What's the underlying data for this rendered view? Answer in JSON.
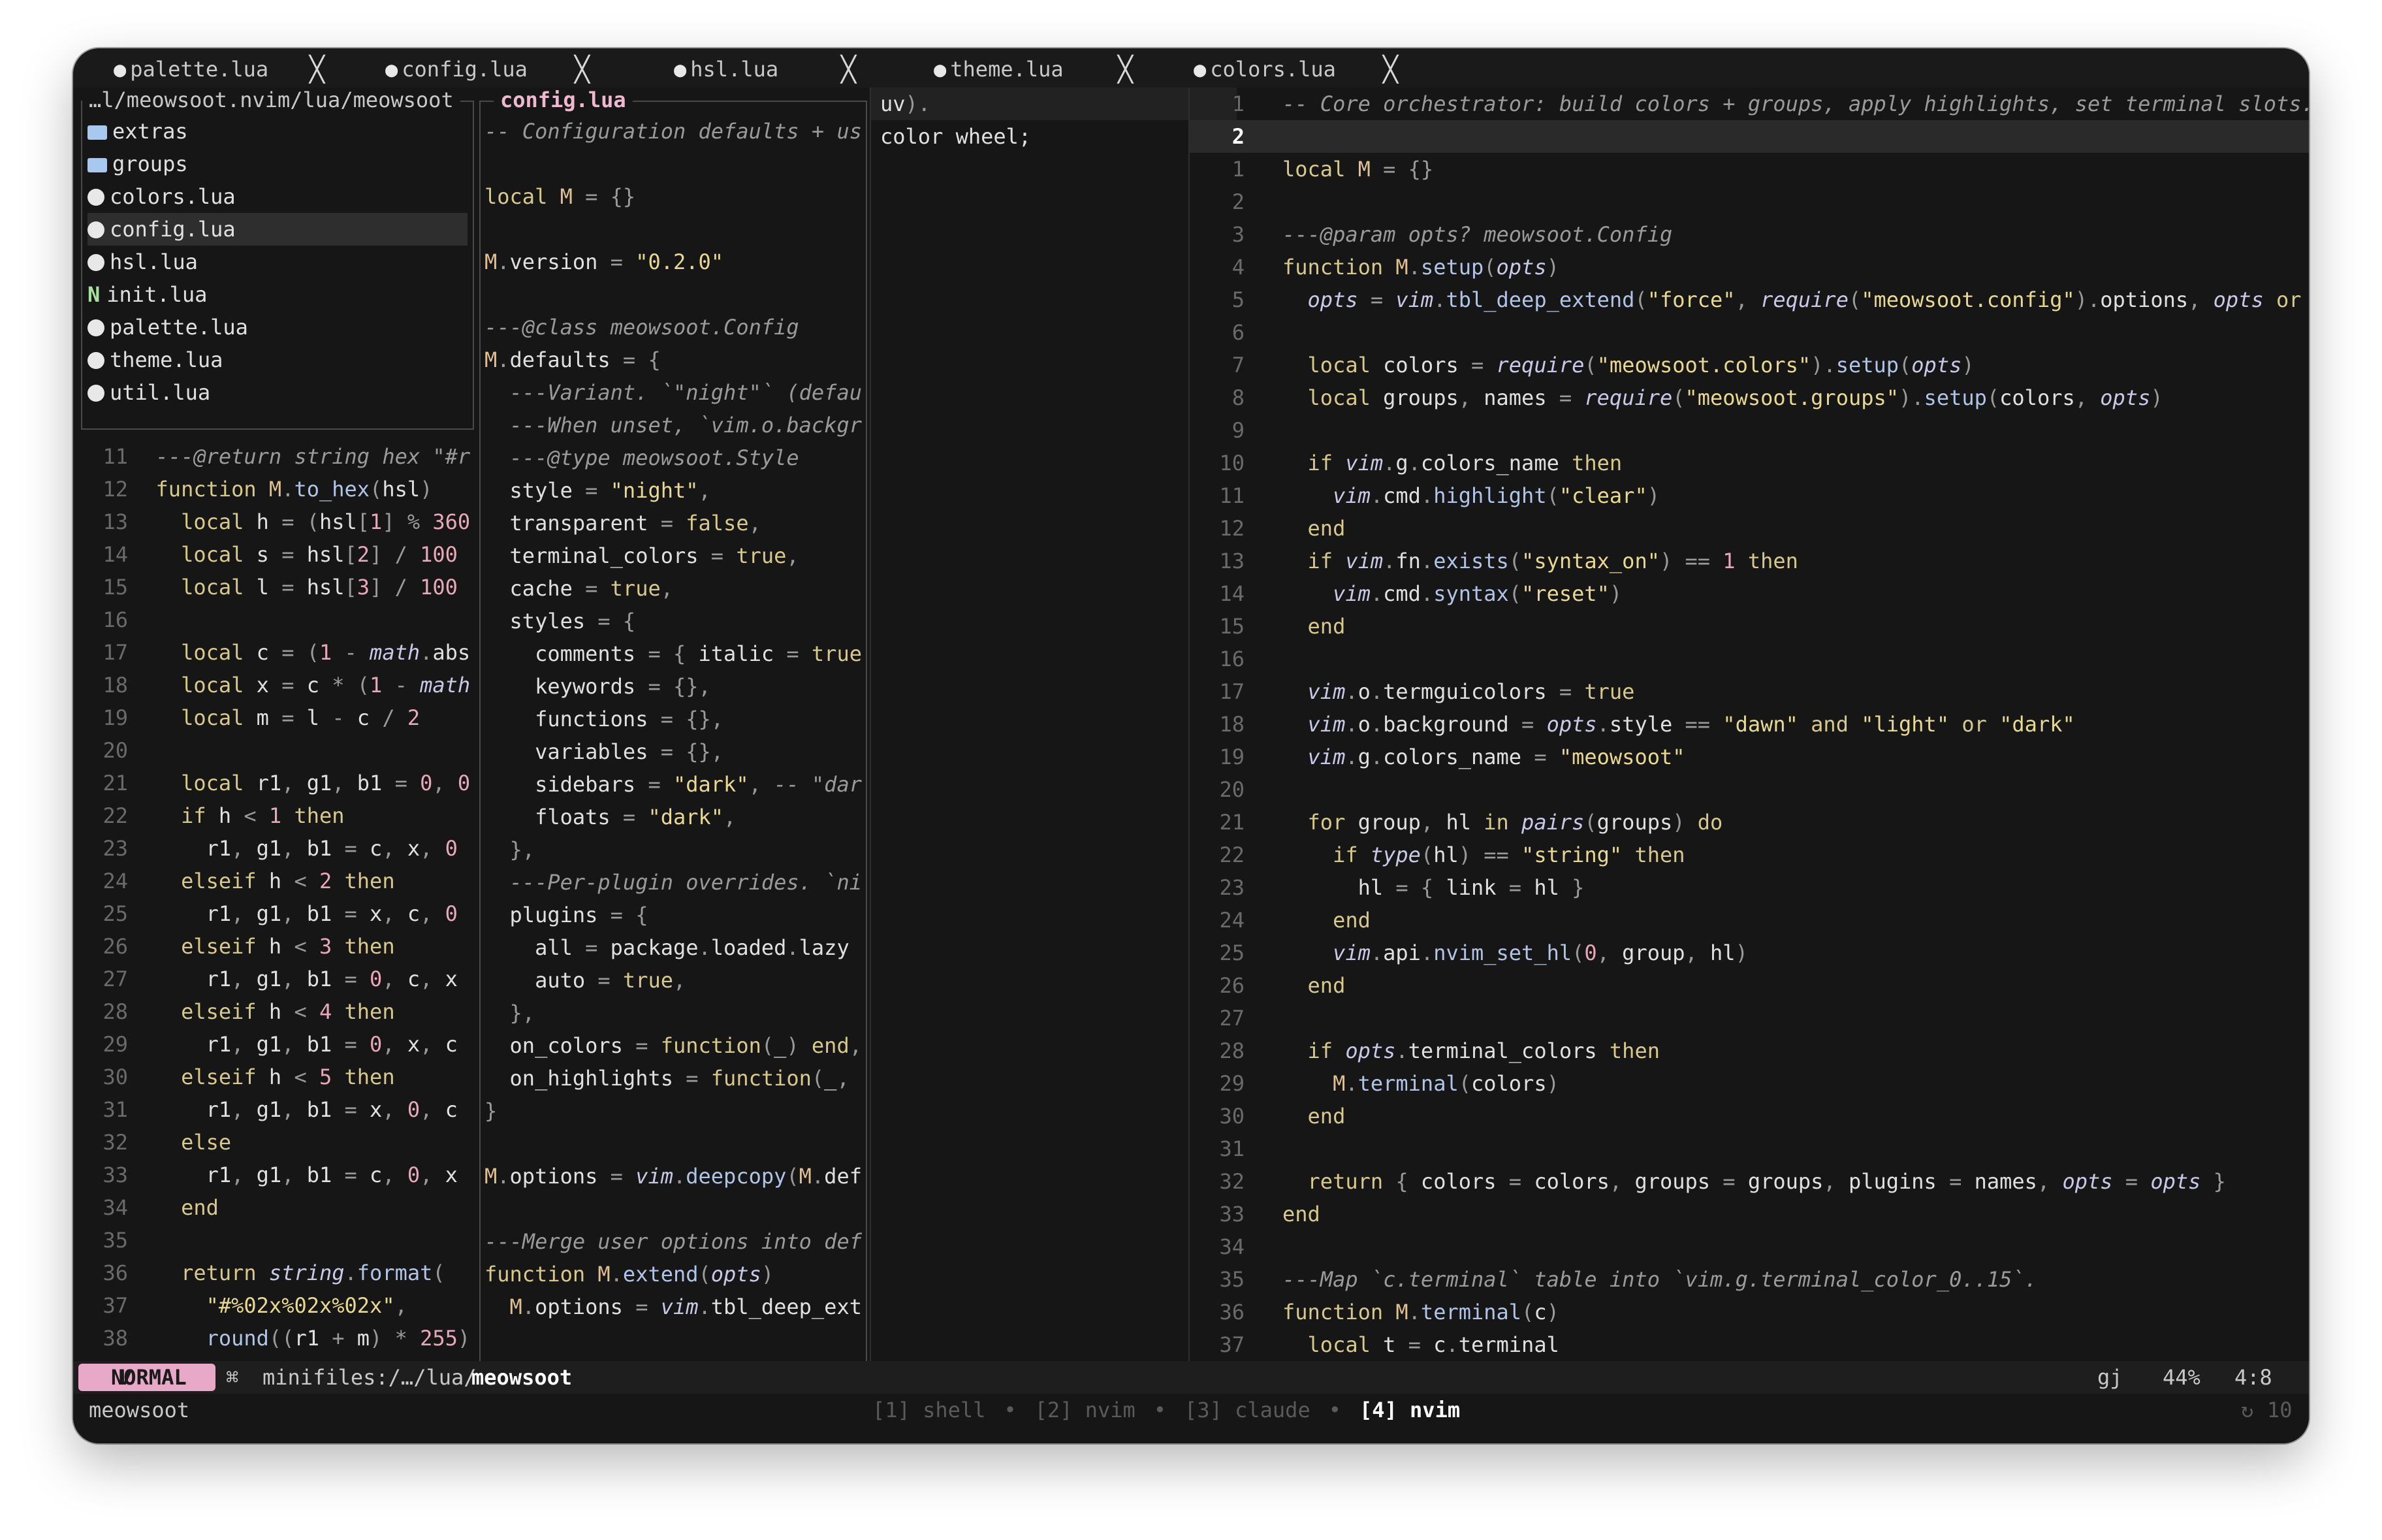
{
  "tabs": [
    {
      "label": "palette.lua",
      "close": "╳"
    },
    {
      "label": "config.lua",
      "close": "╳"
    },
    {
      "label": "hsl.lua",
      "close": "╳"
    },
    {
      "label": "theme.lua",
      "close": "╳"
    },
    {
      "label": "colors.lua",
      "close": "╳"
    }
  ],
  "explorer": {
    "path": "…l/meowsoot.nvim/lua/meowsoot",
    "items": [
      {
        "name": "extras",
        "type": "folder"
      },
      {
        "name": "groups",
        "type": "folder"
      },
      {
        "name": "colors.lua",
        "type": "lua"
      },
      {
        "name": "config.lua",
        "type": "lua",
        "selected": true
      },
      {
        "name": "hsl.lua",
        "type": "lua"
      },
      {
        "name": "init.lua",
        "type": "init"
      },
      {
        "name": "palette.lua",
        "type": "lua"
      },
      {
        "name": "theme.lua",
        "type": "lua"
      },
      {
        "name": "util.lua",
        "type": "lua"
      }
    ]
  },
  "hsl_pane": {
    "lines": [
      {
        "n": "11",
        "t": "  ---@return string hex \"#r"
      },
      {
        "n": "12",
        "t": "  function M.to_hex(hsl)"
      },
      {
        "n": "13",
        "t": "    local h = (hsl[1] % 360"
      },
      {
        "n": "14",
        "t": "    local s = hsl[2] / 100"
      },
      {
        "n": "15",
        "t": "    local l = hsl[3] / 100"
      },
      {
        "n": "16",
        "t": ""
      },
      {
        "n": "17",
        "t": "    local c = (1 - math.abs"
      },
      {
        "n": "18",
        "t": "    local x = c * (1 - math"
      },
      {
        "n": "19",
        "t": "    local m = l - c / 2"
      },
      {
        "n": "20",
        "t": ""
      },
      {
        "n": "21",
        "t": "    local r1, g1, b1 = 0, 0"
      },
      {
        "n": "22",
        "t": "    if h < 1 then"
      },
      {
        "n": "23",
        "t": "      r1, g1, b1 = c, x, 0"
      },
      {
        "n": "24",
        "t": "    elseif h < 2 then"
      },
      {
        "n": "25",
        "t": "      r1, g1, b1 = x, c, 0"
      },
      {
        "n": "26",
        "t": "    elseif h < 3 then"
      },
      {
        "n": "27",
        "t": "      r1, g1, b1 = 0, c, x"
      },
      {
        "n": "28",
        "t": "    elseif h < 4 then"
      },
      {
        "n": "29",
        "t": "      r1, g1, b1 = 0, x, c"
      },
      {
        "n": "30",
        "t": "    elseif h < 5 then"
      },
      {
        "n": "31",
        "t": "      r1, g1, b1 = x, 0, c"
      },
      {
        "n": "32",
        "t": "    else"
      },
      {
        "n": "33",
        "t": "      r1, g1, b1 = c, 0, x"
      },
      {
        "n": "34",
        "t": "    end"
      },
      {
        "n": "35",
        "t": ""
      },
      {
        "n": "36",
        "t": "    return string.format("
      },
      {
        "n": "37",
        "t": "      \"#%02x%02x%02x\","
      },
      {
        "n": "38",
        "t": "      round((r1 + m) * 255)"
      }
    ]
  },
  "config_float": {
    "title": "config.lua",
    "lines": [
      "-- Configuration defaults + us",
      "",
      "local M = {}",
      "",
      "M.version = \"0.2.0\"",
      "",
      "---@class meowsoot.Config",
      "M.defaults = {",
      "  ---Variant. `\"night\"` (defau",
      "  ---When unset, `vim.o.backgr",
      "  ---@type meowsoot.Style",
      "  style = \"night\",",
      "  transparent = false,",
      "  terminal_colors = true,",
      "  cache = true,",
      "  styles = {",
      "    comments = { italic = true",
      "    keywords = {},",
      "    functions = {},",
      "    variables = {},",
      "    sidebars = \"dark\", -- \"dar",
      "    floats = \"dark\",",
      "  },",
      "  ---Per-plugin overrides. `ni",
      "  plugins = {",
      "    all = package.loaded.lazy",
      "    auto = true,",
      "  },",
      "  on_colors = function(_) end,",
      "  on_highlights = function(_,",
      "}",
      "",
      "M.options = vim.deepcopy(M.def",
      "",
      "---Merge user options into def",
      "function M.extend(opts)",
      "  M.options = vim.tbl_deep_ext"
    ]
  },
  "theme_pane": {
    "lines": [
      "uv).",
      "color wheel;"
    ]
  },
  "colors_pane": {
    "lines": [
      {
        "n": "1",
        "t": "-- Core orchestrator: build colors + groups, apply highlights, set terminal slots."
      },
      {
        "n": "2",
        "t": "",
        "current": true
      },
      {
        "n": "1",
        "t": "local M = {}"
      },
      {
        "n": "2",
        "t": ""
      },
      {
        "n": "3",
        "t": "---@param opts? meowsoot.Config"
      },
      {
        "n": "4",
        "t": "function M.setup(opts)"
      },
      {
        "n": "5",
        "t": "  opts = vim.tbl_deep_extend(\"force\", require(\"meowsoot.config\").options, opts or"
      },
      {
        "n": "6",
        "t": ""
      },
      {
        "n": "7",
        "t": "  local colors = require(\"meowsoot.colors\").setup(opts)"
      },
      {
        "n": "8",
        "t": "  local groups, names = require(\"meowsoot.groups\").setup(colors, opts)"
      },
      {
        "n": "9",
        "t": ""
      },
      {
        "n": "10",
        "t": "  if vim.g.colors_name then"
      },
      {
        "n": "11",
        "t": "    vim.cmd.highlight(\"clear\")"
      },
      {
        "n": "12",
        "t": "  end"
      },
      {
        "n": "13",
        "t": "  if vim.fn.exists(\"syntax_on\") == 1 then"
      },
      {
        "n": "14",
        "t": "    vim.cmd.syntax(\"reset\")"
      },
      {
        "n": "15",
        "t": "  end"
      },
      {
        "n": "16",
        "t": ""
      },
      {
        "n": "17",
        "t": "  vim.o.termguicolors = true"
      },
      {
        "n": "18",
        "t": "  vim.o.background = opts.style == \"dawn\" and \"light\" or \"dark\""
      },
      {
        "n": "19",
        "t": "  vim.g.colors_name = \"meowsoot\""
      },
      {
        "n": "20",
        "t": ""
      },
      {
        "n": "21",
        "t": "  for group, hl in pairs(groups) do"
      },
      {
        "n": "22",
        "t": "    if type(hl) == \"string\" then"
      },
      {
        "n": "23",
        "t": "      hl = { link = hl }"
      },
      {
        "n": "24",
        "t": "    end"
      },
      {
        "n": "25",
        "t": "    vim.api.nvim_set_hl(0, group, hl)"
      },
      {
        "n": "26",
        "t": "  end"
      },
      {
        "n": "27",
        "t": ""
      },
      {
        "n": "28",
        "t": "  if opts.terminal_colors then"
      },
      {
        "n": "29",
        "t": "    M.terminal(colors)"
      },
      {
        "n": "30",
        "t": "  end"
      },
      {
        "n": "31",
        "t": ""
      },
      {
        "n": "32",
        "t": "  return { colors = colors, groups = groups, plugins = names, opts = opts }"
      },
      {
        "n": "33",
        "t": "end"
      },
      {
        "n": "34",
        "t": ""
      },
      {
        "n": "35",
        "t": "---Map `c.terminal` table into `vim.g.terminal_color_0..15`."
      },
      {
        "n": "36",
        "t": "function M.terminal(c)"
      },
      {
        "n": "37",
        "t": "  local t = c.terminal"
      }
    ]
  },
  "statusline": {
    "mode": "NORMAL",
    "mode_icon": "V",
    "location_prefix": "minifiles:/…/lua/",
    "location_dir": "meowsoot",
    "keys": "gj",
    "percent": "44%",
    "position": "4:8"
  },
  "cmdline": {
    "session": "meowsoot",
    "windows": [
      "[1] shell",
      "[2] nvim",
      "[3] claude",
      "[4] nvim"
    ],
    "separator": "•",
    "active_window": 3,
    "count": "10"
  },
  "colors": {
    "background": "#161616",
    "mode_bg": "#e8a8c8",
    "accent": "#f0b8d0"
  }
}
